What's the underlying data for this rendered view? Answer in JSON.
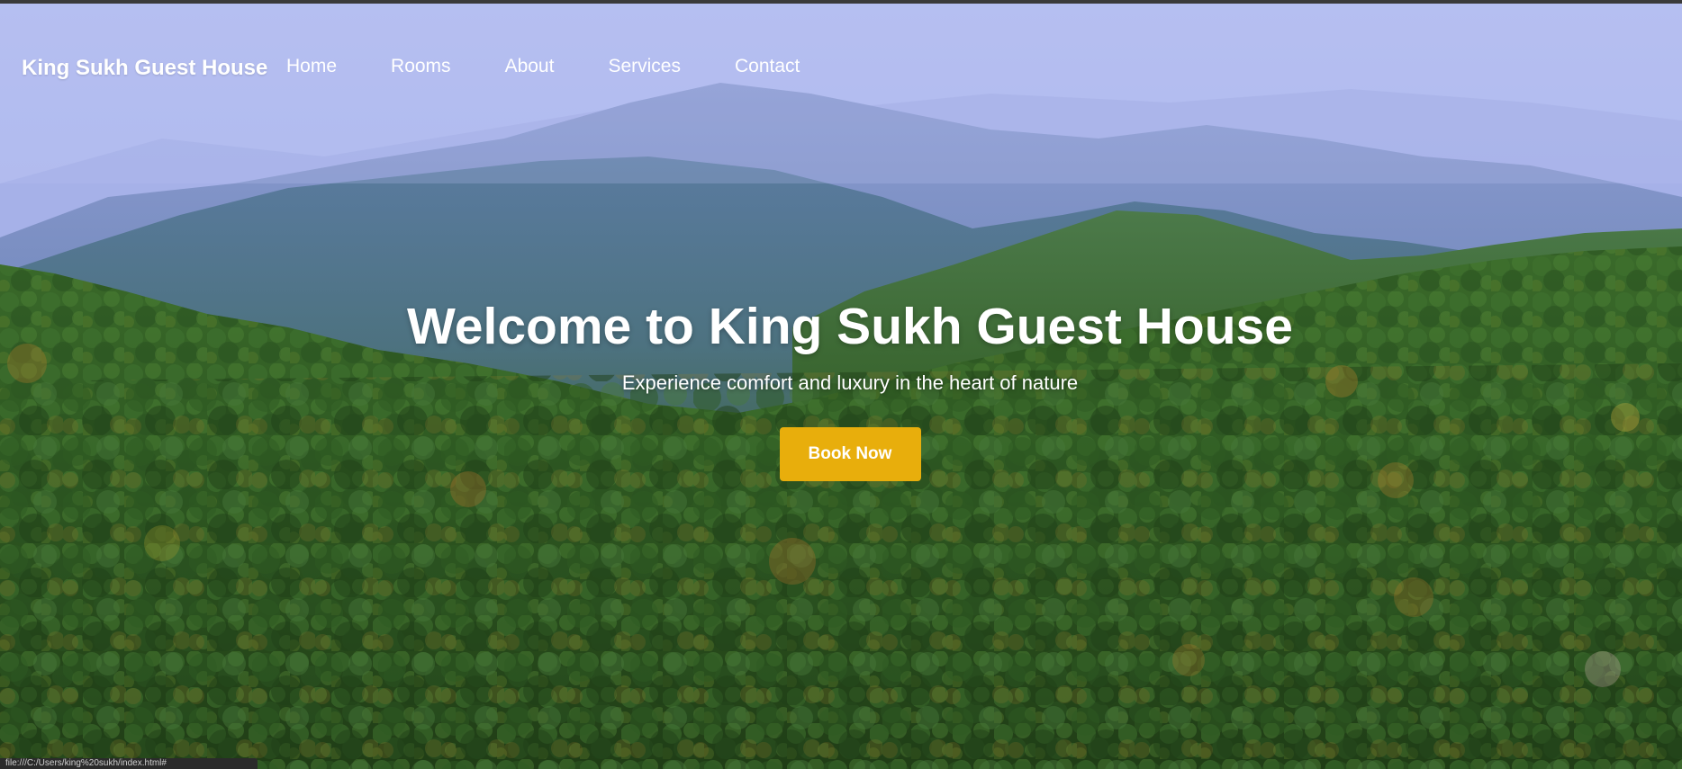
{
  "nav": {
    "brand": "King Sukh Guest House",
    "links": [
      {
        "label": "Home"
      },
      {
        "label": "Rooms"
      },
      {
        "label": "About"
      },
      {
        "label": "Services"
      },
      {
        "label": "Contact"
      }
    ]
  },
  "hero": {
    "title": "Welcome to King Sukh Guest House",
    "subtitle": "Experience comfort and luxury in the heart of nature",
    "cta_label": "Book Now"
  },
  "colors": {
    "accent": "#e8ae0c",
    "sky": "#b7c0f0",
    "forest": "#2f5c2a"
  },
  "status_bar": {
    "text": "file:///C:/Users/king%20sukh/index.html#"
  }
}
